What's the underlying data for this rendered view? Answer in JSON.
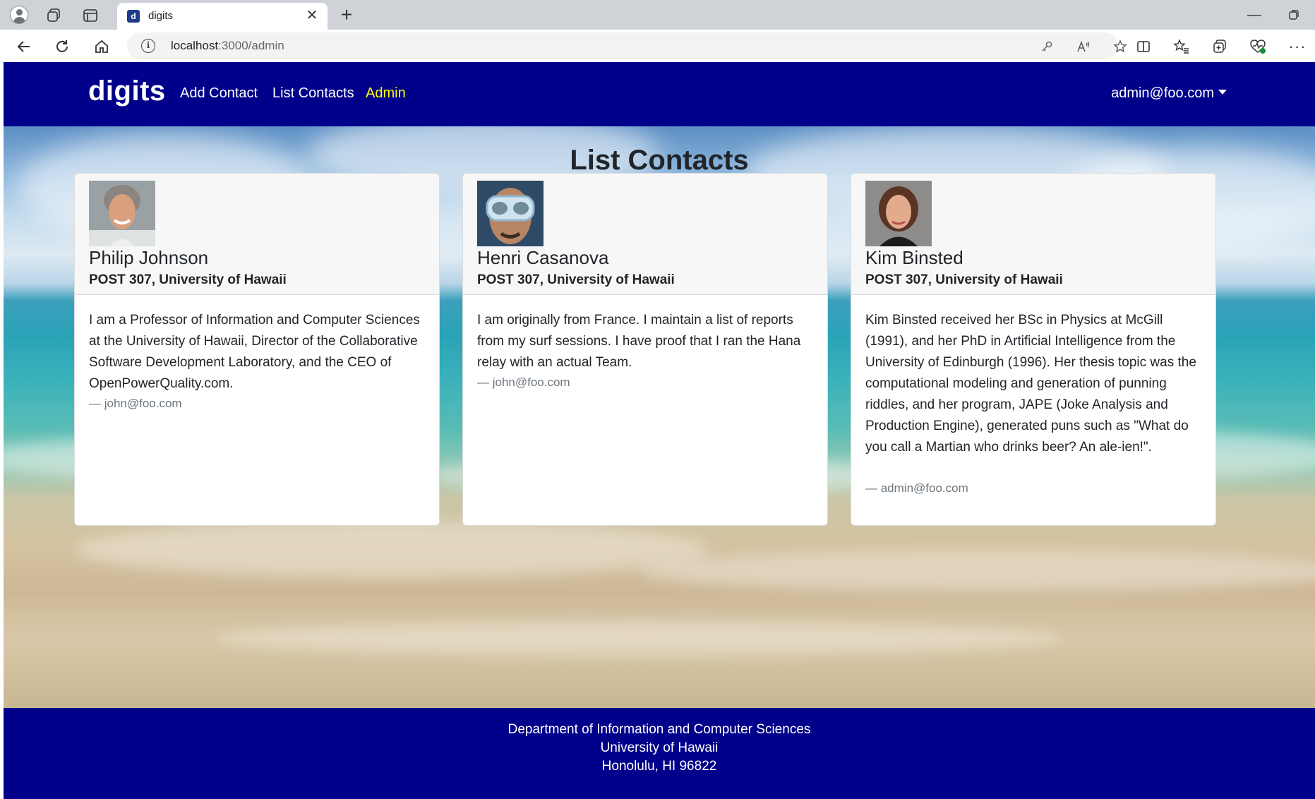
{
  "browser": {
    "tab_title": "digits",
    "tab_favicon_letter": "d",
    "url_host": "localhost",
    "url_path": ":3000/admin",
    "icons": [
      "profile-icon",
      "workspaces-icon",
      "tab-actions-icon",
      "close-icon",
      "plus-icon",
      "minimize-icon",
      "restore-icon",
      "back-icon",
      "reload-icon",
      "home-icon",
      "info-icon",
      "key-icon",
      "read-aloud-icon",
      "star-icon",
      "split-screen-icon",
      "favorites-icon",
      "collections-icon",
      "browser-essentials-icon",
      "more-icon"
    ]
  },
  "navbar": {
    "brand": "digits",
    "links": {
      "add_contact": "Add Contact",
      "list_contacts": "List Contacts",
      "admin": "Admin"
    },
    "user": "admin@foo.com",
    "active_color": "#ffff00",
    "bg_color": "#00008b"
  },
  "main": {
    "title": "List Contacts",
    "contacts": [
      {
        "name": "Philip Johnson",
        "address": "POST 307, University of Hawaii",
        "description": "I am a Professor of Information and Computer Sciences at the University of Hawaii, Director of the Collaborative Software Development Laboratory, and the CEO of OpenPowerQuality.com.",
        "owner": "— john@foo.com"
      },
      {
        "name": "Henri Casanova",
        "address": "POST 307, University of Hawaii",
        "description": "I am originally from France. I maintain a list of reports from my surf sessions. I have proof that I ran the Hana relay with an actual Team.",
        "owner": "— john@foo.com"
      },
      {
        "name": "Kim Binsted",
        "address": "POST 307, University of Hawaii",
        "description": "Kim Binsted received her BSc in Physics at McGill (1991), and her PhD in Artificial Intelligence from the University of Edinburgh (1996). Her thesis topic was the computational modeling and generation of punning riddles, and her program, JAPE (Joke Analysis and Production Engine), generated puns such as \"What do you call a Martian who drinks beer? An ale-ien!\".",
        "owner": "— admin@foo.com"
      }
    ]
  },
  "footer": {
    "line1": "Department of Information and Computer Sciences",
    "line2": "University of Hawaii",
    "line3": "Honolulu, HI 96822"
  }
}
